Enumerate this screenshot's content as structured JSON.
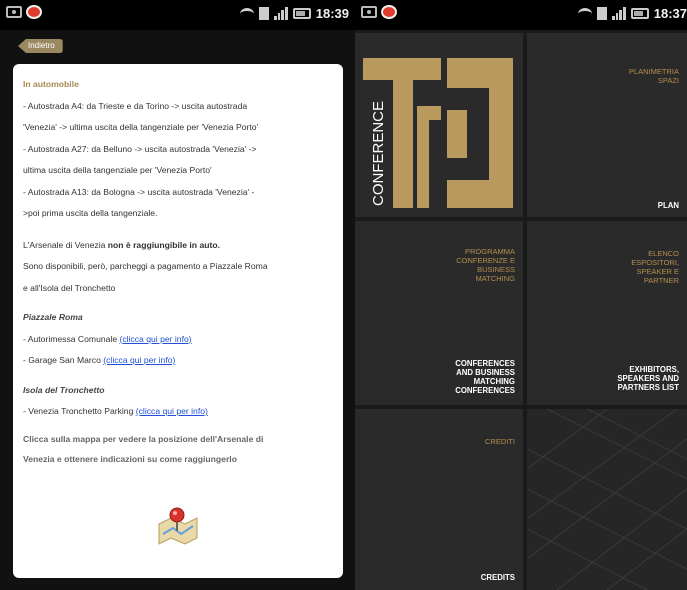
{
  "status_left": {
    "time": "18:39"
  },
  "status_right": {
    "time": "18:37"
  },
  "left": {
    "back_label": "Indietro",
    "heading": "In automobile",
    "directions": [
      "- Autostrada A4: da Trieste e da Torino -> uscita autostrada",
      "'Venezia' -> ultima uscita della tangenziale per 'Venezia Porto'",
      "- Autostrada A27: da Belluno -> uscita autostrada 'Venezia' ->",
      "ultima uscita della tangenziale per 'Venezia Porto'",
      "- Autostrada A13: da Bologna -> uscita autostrada 'Venezia' -",
      ">poi prima uscita della tangenziale."
    ],
    "arsenale_pre": "L'Arsenale di Venezia ",
    "arsenale_bold": "non è raggiungibile in auto.",
    "parking_line1": "Sono disponibili, però, parcheggi a pagamento a Piazzale Roma",
    "parking_line2": "e all'Isola del Tronchetto",
    "section1_title": "Piazzale Roma",
    "section1_items": [
      {
        "text": " - Autorimessa Comunale ",
        "link": "(clicca qui per info)"
      },
      {
        "text": " - Garage San Marco ",
        "link": "(clicca qui per info)"
      }
    ],
    "section2_title": "Isola del Tronchetto",
    "section2_items": [
      {
        "text": " - Venezia Tronchetto Parking ",
        "link": "(clicca qui per info)"
      }
    ],
    "cta_line1": "Clicca sulla mappa per vedere la posizione dell'Arsenale di",
    "cta_line2": "Venezia e ottenere indicazioni su come raggiungerlo",
    "map_icon": "map-pin-icon"
  },
  "right": {
    "logo_text": "CONFERENCE",
    "logo_letters": "T",
    "tiles": {
      "plan_sub_1": "PLANIMETRIA",
      "plan_sub_2": "SPAZI",
      "plan_main": "PLAN",
      "prog_sub": [
        "PROGRAMMA",
        "CONFERENZE E",
        "BUSINESS",
        "MATCHING"
      ],
      "prog_main": [
        "CONFERENCES",
        "AND BUSINESS",
        "MATCHING",
        "CONFERENCES"
      ],
      "exh_sub": [
        "ELENCO",
        "ESPOSITORI,",
        "SPEAKER E",
        "PARTNER"
      ],
      "exh_main": [
        "EXHIBITORS,",
        "SPEAKERS AND",
        "PARTNERS LIST"
      ],
      "credits_sub": "CREDITI",
      "credits_main": "CREDITS"
    },
    "accent": "#b38f4e"
  }
}
